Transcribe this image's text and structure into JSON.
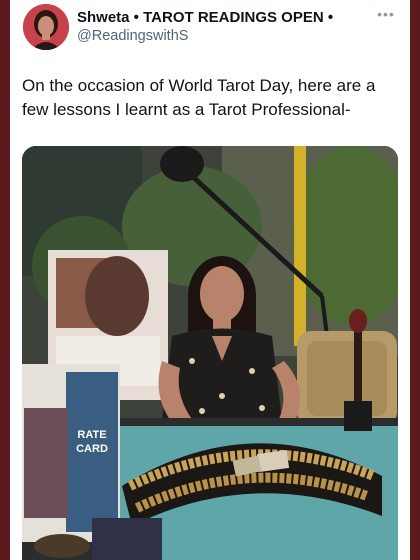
{
  "post": {
    "display_name": "Shweta • TAROT READINGS OPEN •",
    "handle": "@ReadingswithS",
    "text": "On the occasion of World Tarot Day, here are a few lessons I learnt as a Tarot Professional-",
    "more_icon": "more-horizontal-icon"
  },
  "photo": {
    "sign_text": "RATE CARD"
  }
}
